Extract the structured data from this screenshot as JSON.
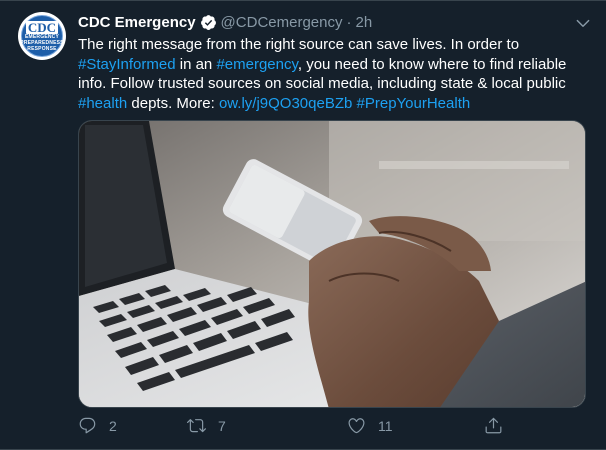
{
  "account": {
    "display_name": "CDC Emergency",
    "handle": "@CDCemergency",
    "dot": "·",
    "time": "2h",
    "avatar": {
      "logo": "CDC",
      "line1": "EMERGENCY",
      "line2": "PREPAREDNESS",
      "line3": "RESPONSE"
    }
  },
  "tweet": {
    "t1": "The right message from the right source can save lives. In order to ",
    "h1": "#StayInformed",
    "t2": " in an ",
    "h2": "#emergency",
    "t3": ", you need to know where to find reliable info. Follow trusted sources on social media, including state & local public ",
    "h3": "#health",
    "t4": " depts. More: ",
    "link": "ow.ly/j9QO30qeBZb",
    "t5": " ",
    "h4": "#PrepYourHealth"
  },
  "actions": {
    "replies": "2",
    "retweets": "7",
    "likes": "11"
  },
  "icons": {
    "verified": "verified-badge-icon",
    "more": "chevron-down-icon",
    "reply": "reply-icon",
    "retweet": "retweet-icon",
    "like": "heart-icon",
    "share": "share-icon"
  },
  "colors": {
    "background": "#15202b",
    "link": "#1da1f2",
    "muted": "#8899a6"
  }
}
